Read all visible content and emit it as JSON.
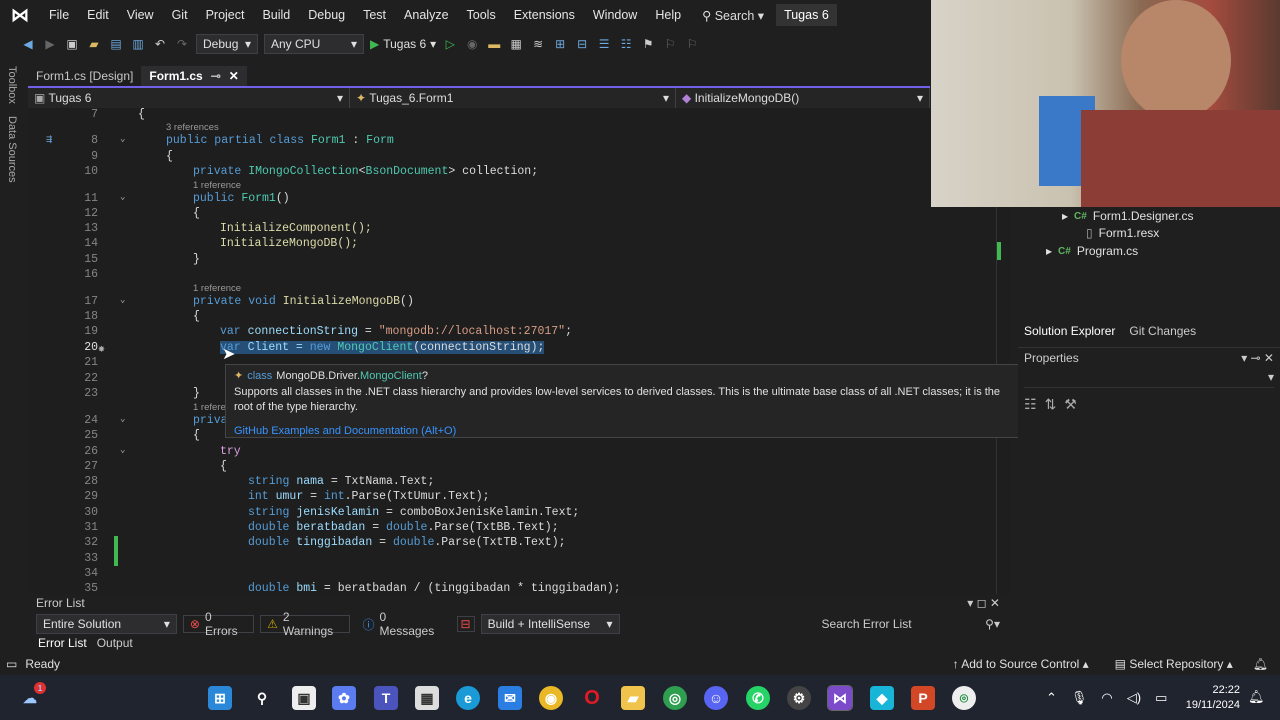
{
  "menu": [
    "File",
    "Edit",
    "View",
    "Git",
    "Project",
    "Build",
    "Debug",
    "Test",
    "Analyze",
    "Tools",
    "Extensions",
    "Window",
    "Help"
  ],
  "search_label": "Search",
  "solution_name": "Tugas 6",
  "toolbar": {
    "config": "Debug",
    "platform": "Any CPU",
    "run_label": "Tugas 6"
  },
  "tabs": [
    {
      "label": "Form1.cs [Design]"
    },
    {
      "label": "Form1.cs"
    }
  ],
  "navbar": {
    "project": "Tugas 6",
    "class": "Tugas_6.Form1",
    "member": "InitializeMongoDB()"
  },
  "side_tabs": [
    "Toolbox",
    "Data Sources"
  ],
  "code": {
    "ln7": "7",
    "ln8": "8",
    "ln9": "9",
    "ln10": "10",
    "ln11": "11",
    "ln12": "12",
    "ln13": "13",
    "ln14": "14",
    "ln15": "15",
    "ln16": "16",
    "ln17": "17",
    "ln18": "18",
    "ln19": "19",
    "ln20": "20",
    "ln21": "21",
    "ln22": "22",
    "ln23": "23",
    "ln24": "24",
    "ln25": "25",
    "ln26": "26",
    "ln27": "27",
    "ln28": "28",
    "ln29": "29",
    "ln30": "30",
    "ln31": "31",
    "ln32": "32",
    "ln33": "33",
    "ln34": "34",
    "ln35": "35",
    "ref3": "3 references",
    "ref1": "1 reference",
    "l8_a": "public partial class ",
    "l8_b": "Form1",
    "l8_c": " : ",
    "l8_d": "Form",
    "l10_a": "private ",
    "l10_b": "IMongoCollection",
    "l10_c": "<",
    "l10_d": "BsonDocument",
    "l10_e": "> collection;",
    "l11_a": "public ",
    "l11_b": "Form1",
    "l11_c": "()",
    "l13": "InitializeComponent();",
    "l14": "InitializeMongoDB();",
    "l17_a": "private void ",
    "l17_b": "InitializeMongoDB",
    "l17_c": "()",
    "l19_a": "var ",
    "l19_b": "connectionString",
    "l19_c": " = ",
    "l19_d": "\"mongodb://localhost:27017\"",
    "l19_e": ";",
    "l20_a": "var",
    "l20_b": " Client = ",
    "l20_c": "new ",
    "l20_d": "MongoClient",
    "l20_e": "(connectionString);",
    "l24_a": "priva",
    "l24_ref": "1 refere",
    "l26": "try",
    "l28_a": "string ",
    "l28_b": "nama",
    "l28_c": " = TxtNama.Text;",
    "l29_a": "int ",
    "l29_b": "umur",
    "l29_c": " = ",
    "l29_d": "int",
    "l29_e": ".Parse(TxtUmur.Text);",
    "l30_a": "string ",
    "l30_b": "jenisKelamin",
    "l30_c": " = comboBoxJenisKelamin.Text;",
    "l31_a": "double ",
    "l31_b": "beratbadan",
    "l31_c": " = ",
    "l31_d": "double",
    "l31_e": ".Parse(TxtBB.Text);",
    "l32_a": "double ",
    "l32_b": "tinggibadan",
    "l32_c": " = ",
    "l32_d": "double",
    "l32_e": ".Parse(TxtTB.Text);",
    "l35_a": "double ",
    "l35_b": "bmi",
    "l35_c": " = beratbadan / (tinggibadan * tinggibadan);"
  },
  "tooltip": {
    "kind": "class",
    "ns": "MongoDB.Driver.",
    "cls": "MongoClient",
    "suffix": "?",
    "desc": "Supports all classes in the .NET class hierarchy and provides low-level services to derived classes. This is the ultimate base class of all .NET classes; it is the root of the type hierarchy.",
    "link": "GitHub Examples and Documentation (Alt+O)"
  },
  "solution_explorer": {
    "items": [
      "Form1.Designer.cs",
      "Form1.resx",
      "Program.cs"
    ],
    "tabs": [
      "Solution Explorer",
      "Git Changes"
    ]
  },
  "properties_title": "Properties",
  "error_list": {
    "title": "Error List",
    "scope": "Entire Solution",
    "errors": "0 Errors",
    "warnings": "2 Warnings",
    "messages": "0 Messages",
    "source": "Build + IntelliSense",
    "search": "Search Error List",
    "tabs": [
      "Error List",
      "Output"
    ]
  },
  "status": {
    "ready": "Ready",
    "source_control": "Add to Source Control",
    "repo": "Select Repository"
  },
  "taskbar": {
    "time": "22:22",
    "date": "19/11/2024",
    "badge": "1"
  },
  "colors": {
    "accent": "#7160e8",
    "keyword": "#569cd6",
    "type": "#4ec9b0",
    "string": "#d69d85",
    "selection": "#264f78"
  }
}
